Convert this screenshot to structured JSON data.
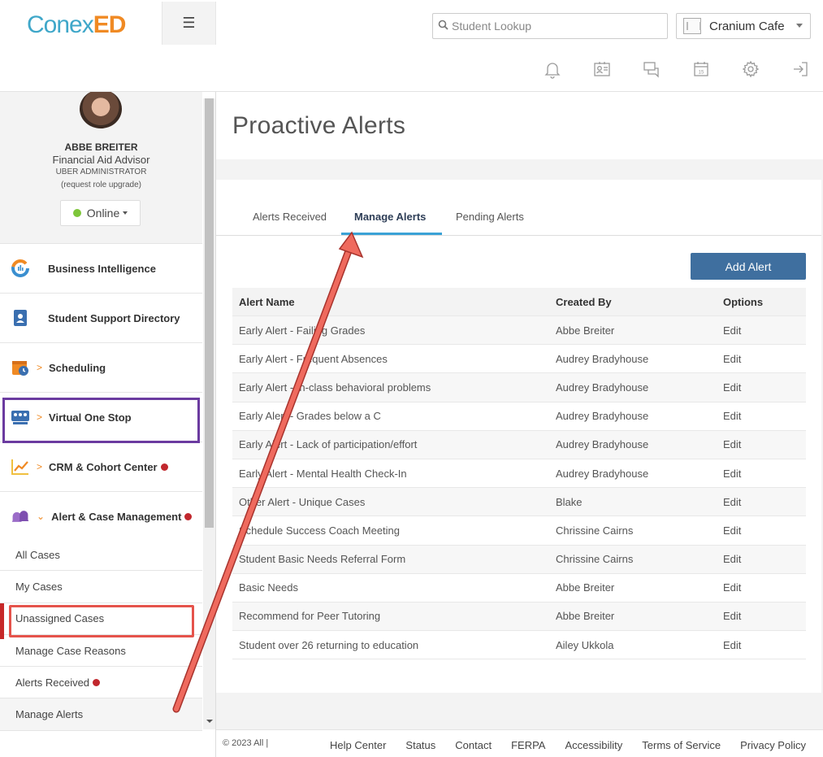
{
  "header": {
    "logo_part1": "Conex",
    "logo_part2": "ED",
    "search_placeholder": "Student Lookup",
    "location": "Cranium Cafe",
    "icons": [
      "bell-icon",
      "id-card-icon",
      "chat-icon",
      "calendar-icon",
      "gear-icon",
      "logout-icon"
    ],
    "calendar_day": "15"
  },
  "profile": {
    "name": "ABBE BREITER",
    "title": "Financial Aid Advisor",
    "role": "UBER ADMINISTRATOR",
    "upgrade_link": "(request role upgrade)",
    "status": "Online"
  },
  "sidebar": {
    "items": [
      {
        "label": "Business Intelligence"
      },
      {
        "label": "Student Support Directory"
      },
      {
        "label": "Scheduling"
      },
      {
        "label": "Virtual One Stop"
      },
      {
        "label": "CRM & Cohort Center"
      },
      {
        "label": "Alert & Case Management"
      }
    ],
    "sub_items": [
      "All Cases",
      "My Cases",
      "Unassigned Cases",
      "Manage Case Reasons",
      "Alerts Received",
      "Manage Alerts"
    ]
  },
  "main": {
    "page_title": "Proactive Alerts",
    "tabs": [
      "Alerts Received",
      "Manage Alerts",
      "Pending Alerts"
    ],
    "add_button": "Add Alert",
    "columns": [
      "Alert Name",
      "Created By",
      "Options"
    ],
    "rows": [
      {
        "name": "Early Alert - Failing Grades",
        "by": "Abbe Breiter",
        "opt": "Edit"
      },
      {
        "name": "Early Alert - Frequent Absences",
        "by": "Audrey Bradyhouse",
        "opt": "Edit"
      },
      {
        "name": "Early Alert - In-class behavioral problems",
        "by": "Audrey Bradyhouse",
        "opt": "Edit"
      },
      {
        "name": "Early Alert - Grades below a C",
        "by": "Audrey Bradyhouse",
        "opt": "Edit"
      },
      {
        "name": "Early Alert - Lack of participation/effort",
        "by": "Audrey Bradyhouse",
        "opt": "Edit"
      },
      {
        "name": "Early Alert - Mental Health Check-In",
        "by": "Audrey Bradyhouse",
        "opt": "Edit"
      },
      {
        "name": "Other Alert - Unique Cases",
        "by": "Blake",
        "opt": "Edit"
      },
      {
        "name": "Schedule Success Coach Meeting",
        "by": "Chrissine Cairns",
        "opt": "Edit"
      },
      {
        "name": "Student Basic Needs Referral Form",
        "by": "Chrissine Cairns",
        "opt": "Edit"
      },
      {
        "name": "Basic Needs",
        "by": "Abbe Breiter",
        "opt": "Edit"
      },
      {
        "name": "Recommend for Peer Tutoring",
        "by": "Abbe Breiter",
        "opt": "Edit"
      },
      {
        "name": "Student over 26 returning to education",
        "by": "Ailey Ukkola",
        "opt": "Edit"
      }
    ]
  },
  "footer": {
    "copyright": "© 2023 All |",
    "links": [
      "Help Center",
      "Status",
      "Contact",
      "FERPA",
      "Accessibility",
      "Terms of Service",
      "Privacy Policy"
    ]
  },
  "colors": {
    "accent": "#3aa2d6",
    "button": "#3f6f9f",
    "highlight_purple": "#6b3ba0",
    "annotation_red": "#e5534b",
    "notification_dot": "#c1272d",
    "online": "#7dc63a"
  }
}
